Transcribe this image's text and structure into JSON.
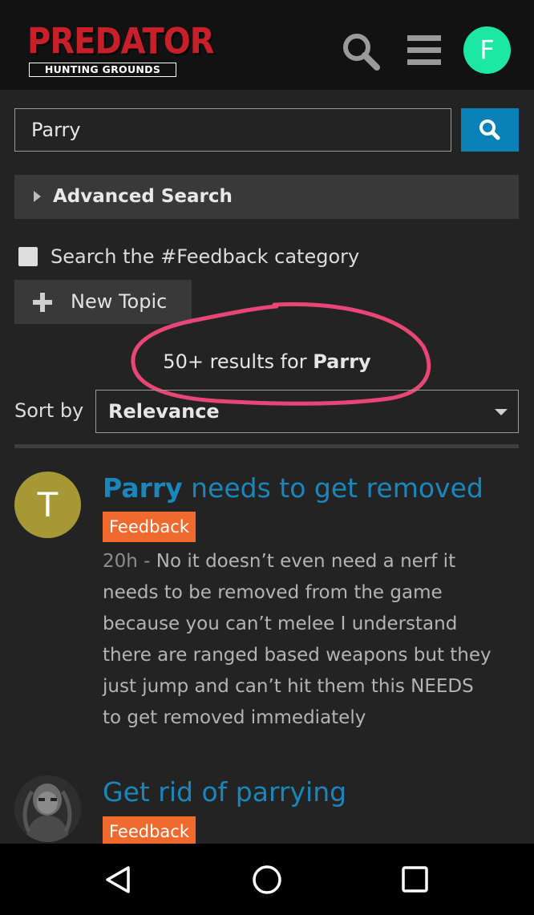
{
  "header": {
    "logo_top": "PREDATOR",
    "logo_bottom": "HUNTING GROUNDS",
    "user_initial": "F",
    "icons": [
      "search-icon",
      "hamburger-menu-icon"
    ],
    "avatar_color": "#1de8a3"
  },
  "search": {
    "value": "Parry",
    "button_icon": "search-icon",
    "button_color": "#0a82b8"
  },
  "advanced_search": {
    "label": "Advanced Search"
  },
  "feedback_filter": {
    "label": "Search the #Feedback category",
    "checked": false
  },
  "new_topic": {
    "label": "New Topic"
  },
  "results": {
    "prefix": "50+ results for ",
    "term": "Parry"
  },
  "sort": {
    "label": "Sort by",
    "selected": "Relevance"
  },
  "posts": [
    {
      "avatar_letter": "T",
      "avatar_color": "#a69834",
      "title_highlight": "Parry",
      "title_rest": " needs to get removed",
      "category": "Feedback",
      "time": "20h - ",
      "excerpt": "No it doesn’t even need a nerf it needs to be removed from the game because you can’t melee I understand there are ranged based weapons but they just jump and can’t hit them this NEEDS to get removed immediately"
    },
    {
      "avatar_letter": "",
      "avatar_icon": "predator-avatar-icon",
      "title_highlight": "",
      "title_rest": "Get rid of parrying",
      "category": "Feedback"
    }
  ],
  "colors": {
    "accent_link": "#1a86bc",
    "category_badge": "#f06a2e",
    "annotation": "#e8457a"
  },
  "navbar": {
    "icons": [
      "back-triangle-icon",
      "home-circle-icon",
      "recents-square-icon"
    ]
  }
}
